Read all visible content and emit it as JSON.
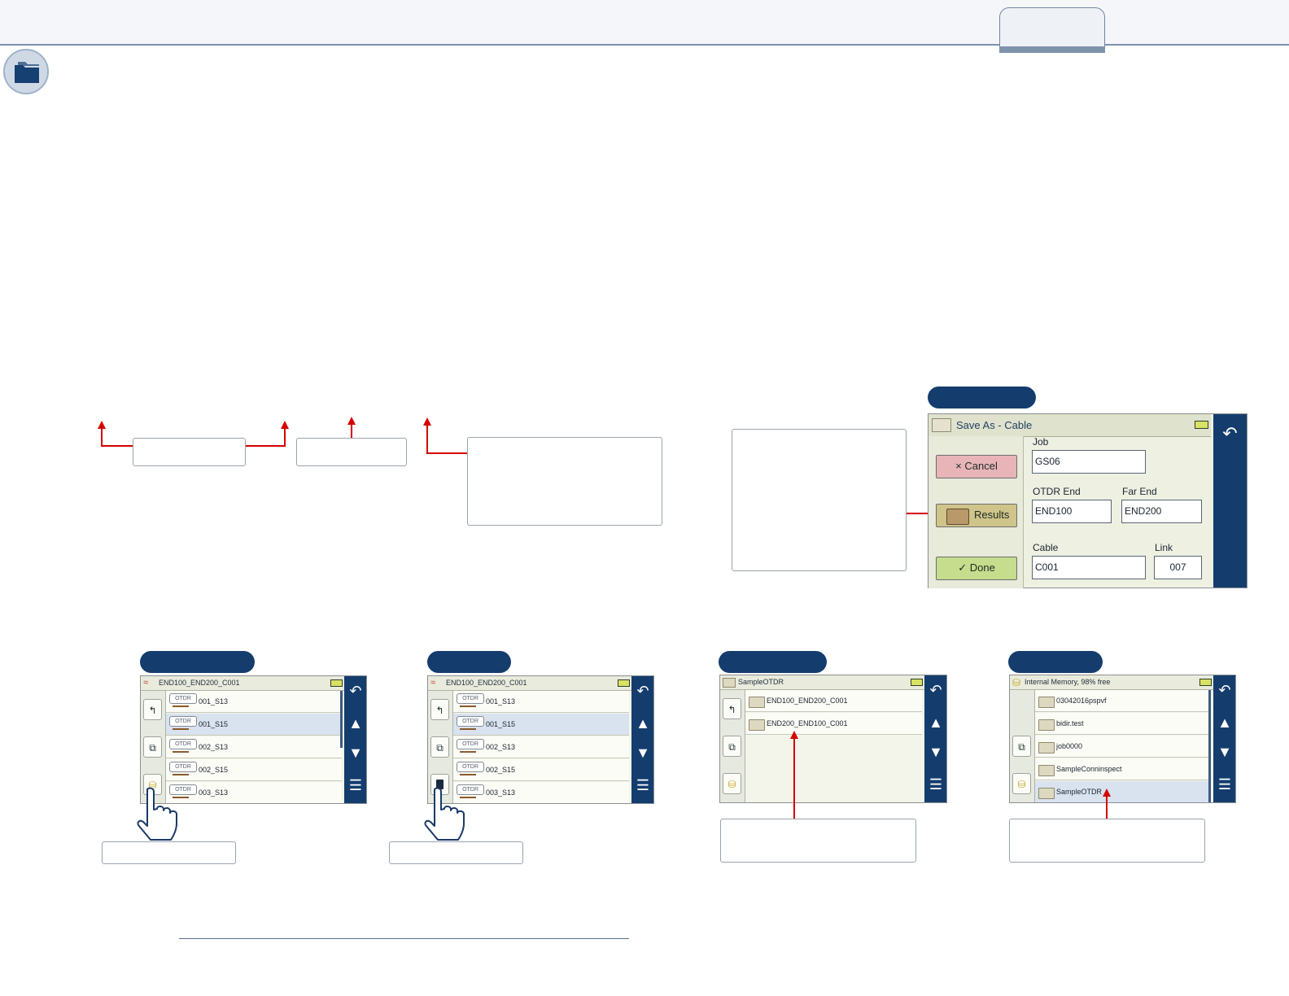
{
  "header": {
    "tab_label": ""
  },
  "screen1": {
    "title": "END100_END200_C001",
    "rows": [
      {
        "tag": "OTDR",
        "name": "001_S13",
        "selected": false
      },
      {
        "tag": "OTDR",
        "name": "001_S15",
        "selected": true
      },
      {
        "tag": "OTDR",
        "name": "002_S13",
        "selected": false
      },
      {
        "tag": "OTDR",
        "name": "002_S15",
        "selected": false
      },
      {
        "tag": "OTDR",
        "name": "003_S13",
        "selected": false
      }
    ]
  },
  "screen2": {
    "title": "END100_END200_C001",
    "rows": [
      {
        "tag": "OTDR",
        "name": "001_S13",
        "selected": false
      },
      {
        "tag": "OTDR",
        "name": "001_S15",
        "selected": true
      },
      {
        "tag": "OTDR",
        "name": "002_S13",
        "selected": false
      },
      {
        "tag": "OTDR",
        "name": "002_S15",
        "selected": false
      },
      {
        "tag": "OTDR",
        "name": "003_S13",
        "selected": false
      }
    ]
  },
  "screen3": {
    "title": "SampleOTDR",
    "rows": [
      {
        "name": "END100_END200_C001"
      },
      {
        "name": "END200_END100_C001"
      }
    ]
  },
  "screen4": {
    "title": "Internal Memory, 98% free",
    "rows": [
      {
        "name": "03042016pspvf",
        "selected": false
      },
      {
        "name": "bidir.test",
        "selected": false
      },
      {
        "name": "job0000",
        "selected": false
      },
      {
        "name": "SampleConninspect",
        "selected": false
      },
      {
        "name": "SampleOTDR",
        "selected": true
      }
    ]
  },
  "save_dialog": {
    "title": "Save As - Cable",
    "cancel_label": "Cancel",
    "cancel_glyph": "×",
    "results_label": "Results",
    "done_label": "Done",
    "done_glyph": "✓",
    "job_label": "Job",
    "job_value": "GS06",
    "otdr_end_label": "OTDR End",
    "otdr_end_value": "END100",
    "far_end_label": "Far End",
    "far_end_value": "END200",
    "cable_label": "Cable",
    "cable_value": "C001",
    "link_label": "Link",
    "link_value": "007"
  },
  "icons": {
    "back": "↶",
    "up": "▲",
    "down": "▼",
    "menu": "☰",
    "parent_folder": "↰",
    "new_folder": "⧉",
    "storage": "⛁"
  },
  "colors": {
    "accent_navy": "#143d6e",
    "callout_red": "#d40000",
    "cancel_bg": "#e8b4b8",
    "results_bg": "#cfc489",
    "done_bg": "#c5dd8c",
    "selected_row": "#d9e2ef"
  }
}
